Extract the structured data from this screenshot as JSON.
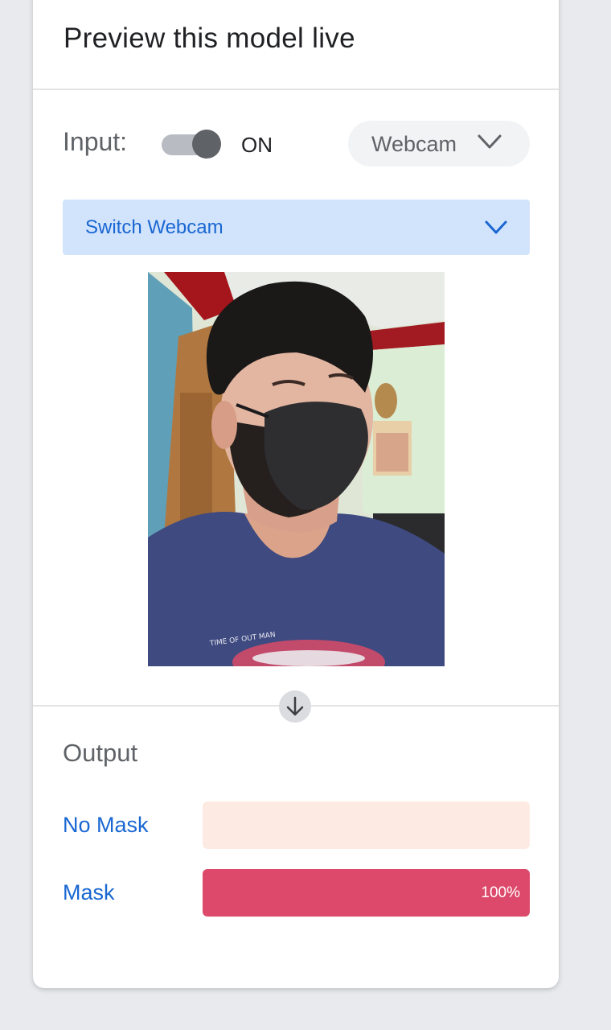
{
  "panel": {
    "title": "Preview this model live"
  },
  "input": {
    "label": "Input:",
    "toggle_state": "ON",
    "source_select_value": "Webcam",
    "switch_webcam_label": "Switch Webcam"
  },
  "preview": {
    "description_icon": "webcam-preview-image"
  },
  "output": {
    "title": "Output",
    "classes": [
      {
        "label": "No Mask",
        "confidence": 0.0,
        "percent_text": ""
      },
      {
        "label": "Mask",
        "confidence": 1.0,
        "percent_text": "100%"
      }
    ]
  },
  "colors": {
    "accent_blue": "#1967d2",
    "switch_bar_bg": "#d2e3fc",
    "bar_bg": "#fdebe3",
    "bar_fill": "#dc496a",
    "page_bg": "#e8eaed"
  },
  "icons": {
    "select_chevron": "chevron-down-icon",
    "switch_chevron": "chevron-down-icon",
    "flow_arrow": "arrow-down-icon"
  }
}
